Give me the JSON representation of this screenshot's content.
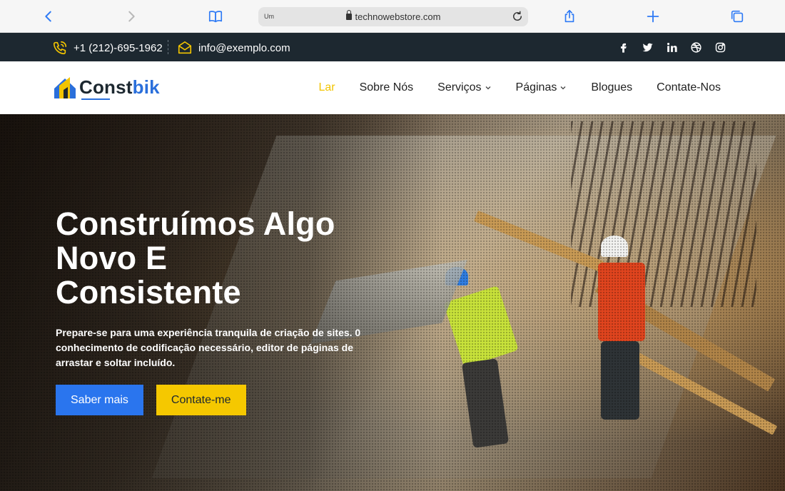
{
  "browser": {
    "url_prefix": "Um",
    "url": "technowebstore.com"
  },
  "topbar": {
    "phone": "+1 (212)-695-1962",
    "email": "info@exemplo.com",
    "socials": [
      "facebook-icon",
      "twitter-icon",
      "linkedin-icon",
      "dribbble-icon",
      "instagram-icon"
    ]
  },
  "brand": {
    "name_main": "Const",
    "name_accent": "bik",
    "accent_color": "#2a6fdb",
    "highlight_color": "#f2c400"
  },
  "nav": {
    "items": [
      {
        "label": "Lar",
        "active": true
      },
      {
        "label": "Sobre Nós"
      },
      {
        "label": "Serviços",
        "dropdown": true
      },
      {
        "label": "Páginas",
        "dropdown": true
      },
      {
        "label": "Blogues"
      },
      {
        "label": "Contate-Nos"
      }
    ]
  },
  "hero": {
    "title_line1": "Construímos Algo",
    "title_line2": "Novo E",
    "title_line3": "Consistente",
    "text": "Prepare-se para uma experiência tranquila de criação de sites. 0 conhecimento de codificação necessário, editor de páginas de arrastar e soltar incluído.",
    "primary_button": "Saber mais",
    "secondary_button": "Contate-me"
  }
}
